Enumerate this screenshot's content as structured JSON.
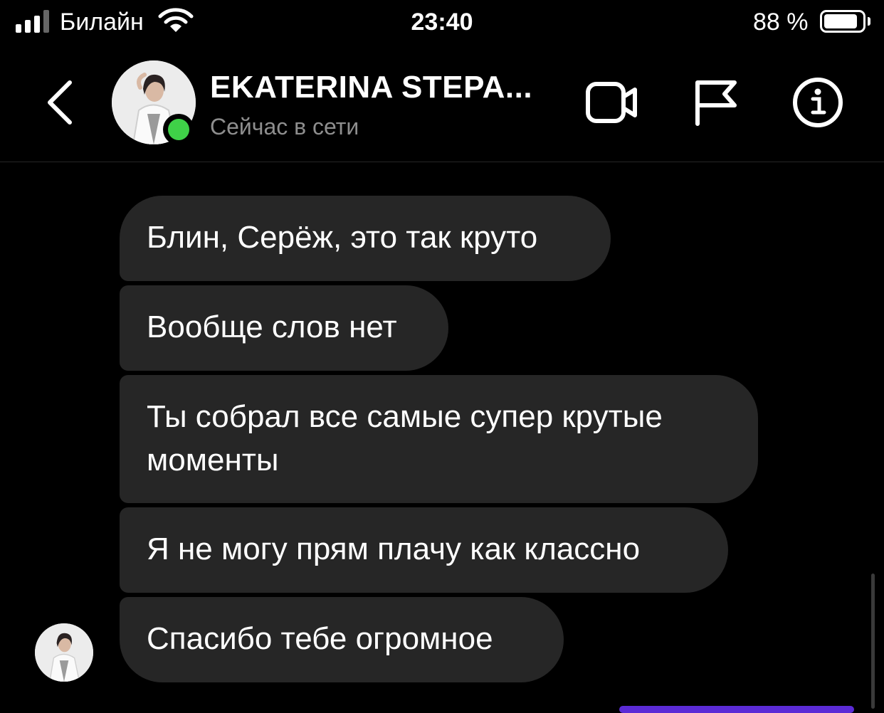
{
  "status_bar": {
    "carrier": "Билайн",
    "time": "23:40",
    "battery_percent": "88 %"
  },
  "header": {
    "contact_name": "EKATERINA STEPA...",
    "contact_status": "Сейчас в сети",
    "icons": [
      "back-icon",
      "video-call-icon",
      "flag-icon",
      "info-icon"
    ]
  },
  "messages": [
    {
      "text": "Блин, Серёж, это так круто"
    },
    {
      "text": "Вообще слов нет"
    },
    {
      "text": "Ты собрал все самые супер крутые\nмоменты"
    },
    {
      "text": "Я не могу прям плачу как классно"
    },
    {
      "text": "Спасибо тебе огромное"
    }
  ],
  "colors": {
    "background": "#000000",
    "bubble": "#262626",
    "online": "#3fd148",
    "secondary_text": "#8e8e8e"
  }
}
